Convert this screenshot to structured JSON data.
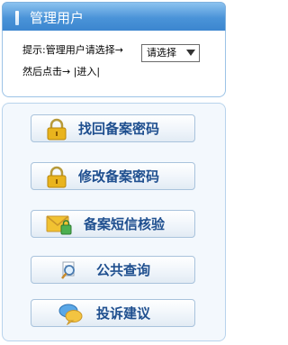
{
  "header": {
    "title": "管理用户"
  },
  "login": {
    "hint_text": "提示:管理用户请选择→",
    "select_value": "请选择",
    "step_text": "然后点击→",
    "enter_label": "|进入|"
  },
  "menu": {
    "items": [
      {
        "label": "找回备案密码",
        "icon": "lock-icon"
      },
      {
        "label": "修改备案密码",
        "icon": "lock-icon"
      },
      {
        "label": "备案短信核验",
        "icon": "envelope-lock-icon"
      },
      {
        "label": "公共查询",
        "icon": "magnifier-icon"
      },
      {
        "label": "投诉建议",
        "icon": "chat-bubbles-icon"
      }
    ]
  },
  "colors": {
    "header_blue": "#3c86cf",
    "button_text": "#1f4f8f",
    "panel_bg": "#f3f8fd"
  }
}
